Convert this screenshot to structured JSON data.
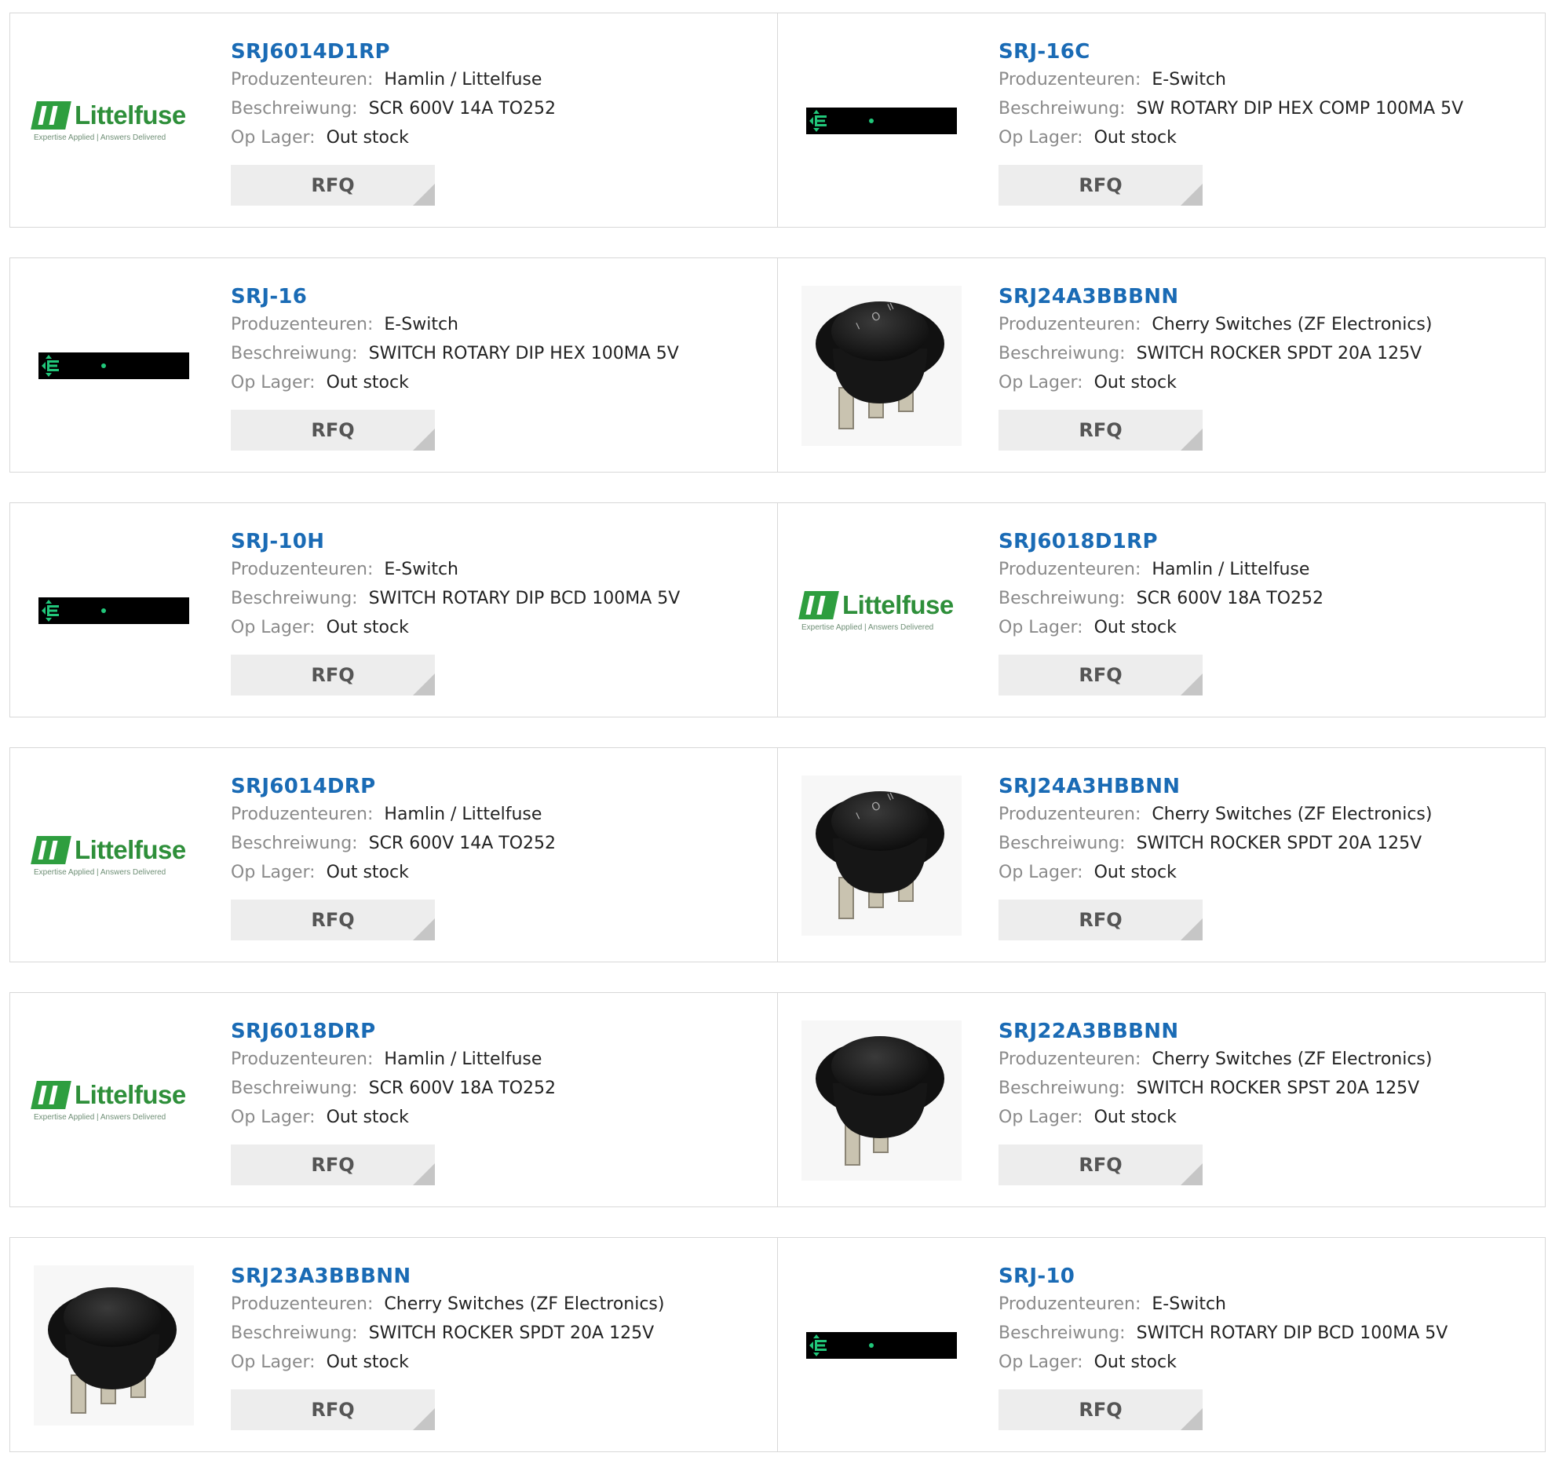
{
  "labels": {
    "manufacturer": "Produzenteuren:",
    "description": "Beschreiwung:",
    "stock": "Op Lager:",
    "rfq": "RFQ"
  },
  "logos": {
    "littelfuse_name": "Littelfuse",
    "littelfuse_tagline": "Expertise Applied | Answers Delivered"
  },
  "colors": {
    "part_link": "#1a6bb5",
    "littelfuse_green": "#2e9e3f",
    "eswitch_green": "#21c77a",
    "rfq_bg": "#ededed"
  },
  "products": [
    {
      "part": "SRJ6014D1RP",
      "manufacturer": "Hamlin / Littelfuse",
      "description": "SCR 600V 14A TO252",
      "stock": "Out stock",
      "image": "littelfuse-logo"
    },
    {
      "part": "SRJ-16C",
      "manufacturer": "E-Switch",
      "description": "SW ROTARY DIP HEX COMP 100MA 5V",
      "stock": "Out stock",
      "image": "eswitch-logo"
    },
    {
      "part": "SRJ-16",
      "manufacturer": "E-Switch",
      "description": "SWITCH ROTARY DIP HEX 100MA 5V",
      "stock": "Out stock",
      "image": "eswitch-logo"
    },
    {
      "part": "SRJ24A3BBBNN",
      "manufacturer": "Cherry Switches (ZF Electronics)",
      "description": "SWITCH ROCKER SPDT 20A 125V",
      "stock": "Out stock",
      "image": "rocker-switch-3pin"
    },
    {
      "part": "SRJ-10H",
      "manufacturer": "E-Switch",
      "description": "SWITCH ROTARY DIP BCD 100MA 5V",
      "stock": "Out stock",
      "image": "eswitch-logo"
    },
    {
      "part": "SRJ6018D1RP",
      "manufacturer": "Hamlin / Littelfuse",
      "description": "SCR 600V 18A TO252",
      "stock": "Out stock",
      "image": "littelfuse-logo"
    },
    {
      "part": "SRJ6014DRP",
      "manufacturer": "Hamlin / Littelfuse",
      "description": "SCR 600V 14A TO252",
      "stock": "Out stock",
      "image": "littelfuse-logo"
    },
    {
      "part": "SRJ24A3HBBNN",
      "manufacturer": "Cherry Switches (ZF Electronics)",
      "description": "SWITCH ROCKER SPDT 20A 125V",
      "stock": "Out stock",
      "image": "rocker-switch-3pin"
    },
    {
      "part": "SRJ6018DRP",
      "manufacturer": "Hamlin / Littelfuse",
      "description": "SCR 600V 18A TO252",
      "stock": "Out stock",
      "image": "littelfuse-logo"
    },
    {
      "part": "SRJ22A3BBBNN",
      "manufacturer": "Cherry Switches (ZF Electronics)",
      "description": "SWITCH ROCKER SPST 20A 125V",
      "stock": "Out stock",
      "image": "rocker-switch-2pin"
    },
    {
      "part": "SRJ23A3BBBNN",
      "manufacturer": "Cherry Switches (ZF Electronics)",
      "description": "SWITCH ROCKER SPDT 20A 125V",
      "stock": "Out stock",
      "image": "rocker-switch-3pin-plain"
    },
    {
      "part": "SRJ-10",
      "manufacturer": "E-Switch",
      "description": "SWITCH ROTARY DIP BCD 100MA 5V",
      "stock": "Out stock",
      "image": "eswitch-logo"
    }
  ]
}
